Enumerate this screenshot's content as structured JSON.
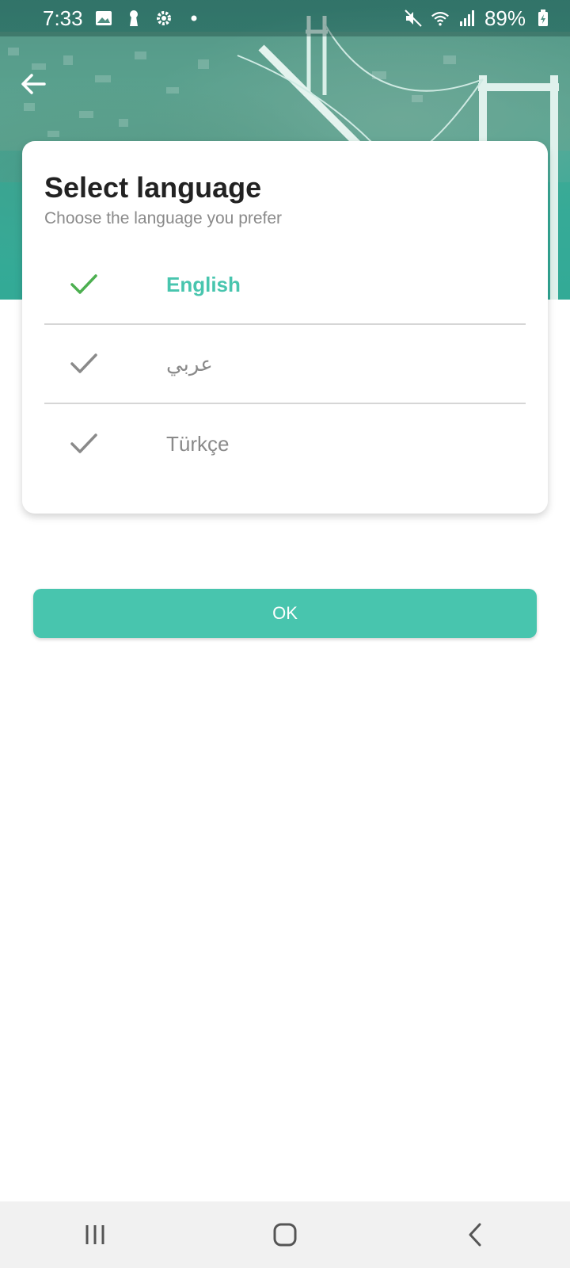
{
  "status_bar": {
    "time": "7:33",
    "battery": "89%",
    "left_icons": [
      "image-icon",
      "keyhole-icon",
      "gear-icon",
      "dot-icon"
    ],
    "right_icons": [
      "mute-icon",
      "wifi-icon",
      "signal-icon",
      "battery-charging-icon"
    ]
  },
  "card": {
    "title": "Select language",
    "subtitle": "Choose the language you prefer"
  },
  "languages": [
    {
      "label": "English",
      "selected": true
    },
    {
      "label": "عربي",
      "selected": false
    },
    {
      "label": "Türkçe",
      "selected": false
    }
  ],
  "ok_button": {
    "label": "OK"
  },
  "colors": {
    "accent": "#48c5ae",
    "check_selected": "#4caf50",
    "check_unselected": "#8a8a8a",
    "text_dark": "#222222",
    "text_muted": "#8a8a8a"
  },
  "nav_bar": {
    "icons": [
      "recent-apps-icon",
      "home-icon",
      "back-icon"
    ]
  }
}
